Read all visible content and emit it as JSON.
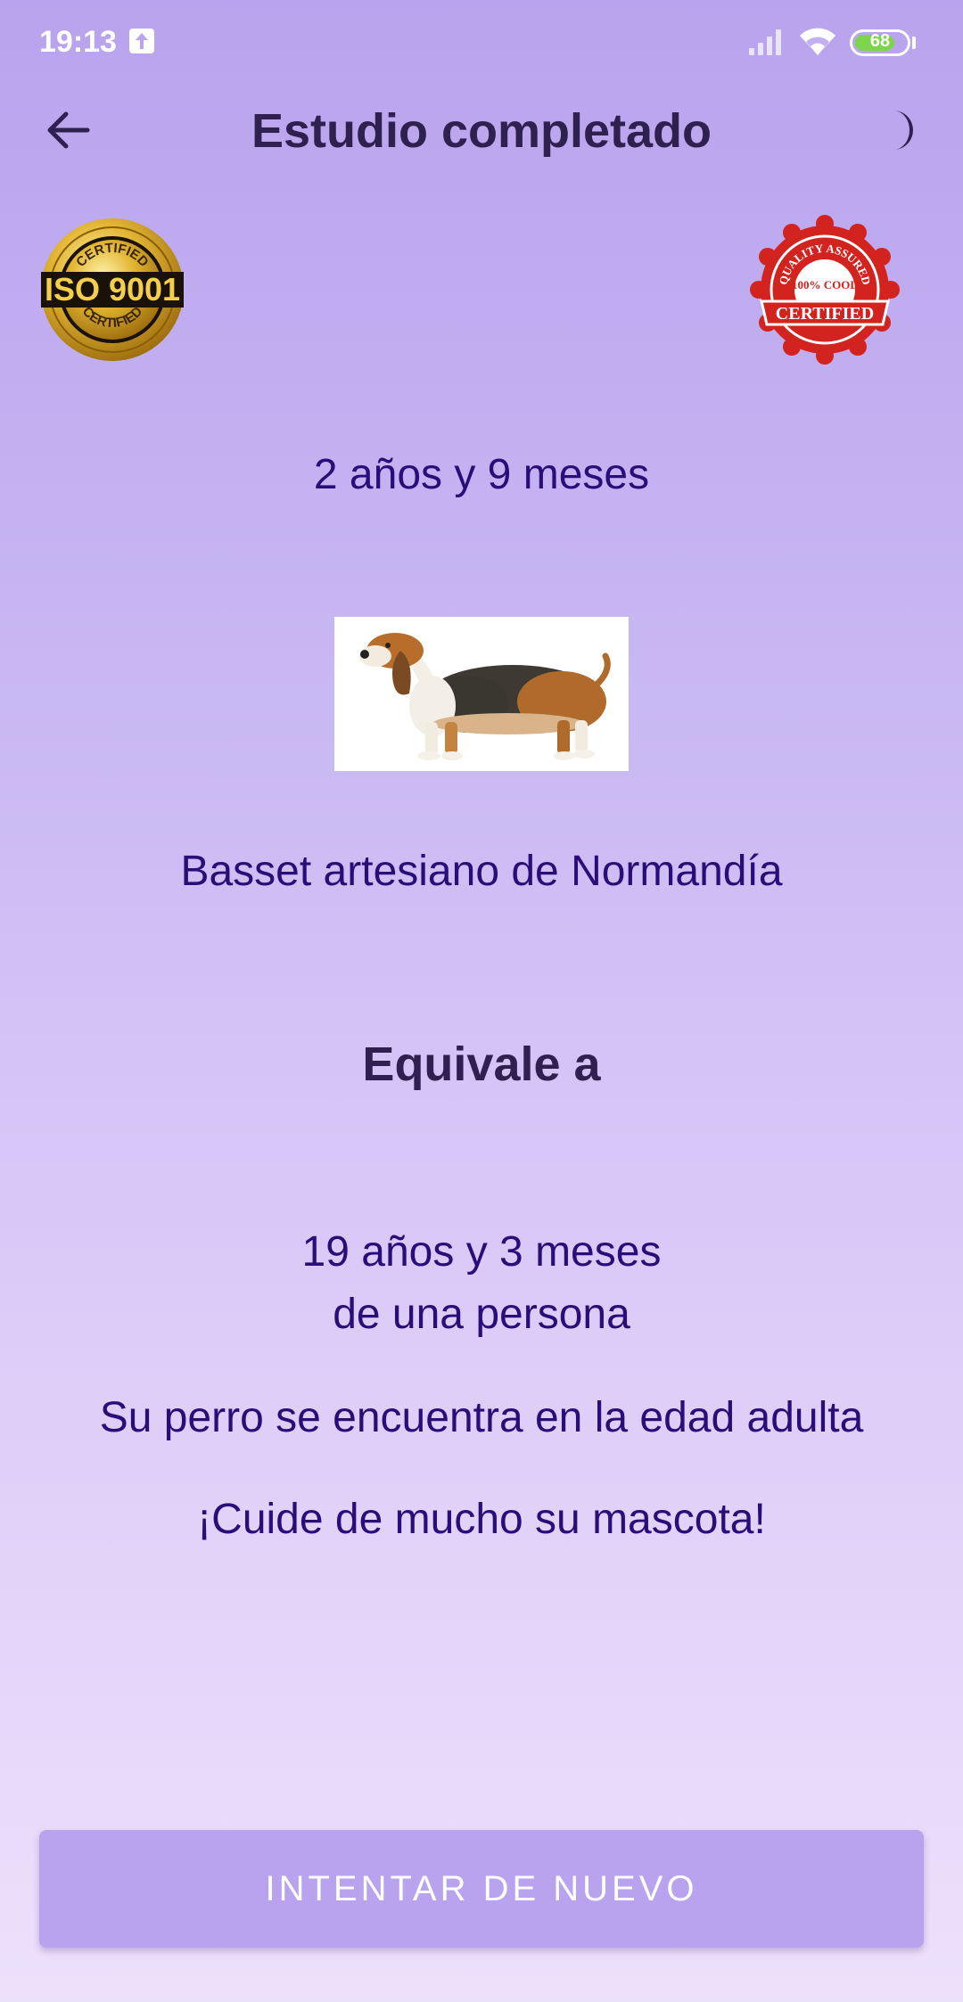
{
  "status_bar": {
    "time": "19:13",
    "battery_level": "68",
    "icons": [
      "upload-icon",
      "signal-icon",
      "wifi-icon",
      "battery-icon"
    ]
  },
  "app_bar": {
    "title": "Estudio completado",
    "back_icon": "arrow-left-icon",
    "theme_icon": "moon-icon"
  },
  "badges": {
    "left": {
      "icon": "iso-certified-badge",
      "text": "ISO 9001",
      "ring_text": "CERTIFIED"
    },
    "right": {
      "icon": "quality-certified-seal",
      "arc_text": "QUALITY ASSURED",
      "center_text": "100% COOL",
      "ribbon_text": "CERTIFIED"
    }
  },
  "result": {
    "dog_age": "2 años y 9 meses",
    "breed": "Basset artesiano de Normandía",
    "equivalent_label": "Equivale a",
    "human_age": "19 años y 3 meses",
    "human_suffix": "de una persona",
    "life_stage": "Su perro se encuentra en la edad adulta",
    "advice": "¡Cuide de mucho su mascota!"
  },
  "actions": {
    "retry_label": "INTENTAR DE NUEVO"
  },
  "colors": {
    "background_top": "#b9a3ee",
    "background_bottom": "#ece1fb",
    "text_primary": "#2a0d78",
    "title": "#2e2150",
    "button": "#b9a3ee"
  }
}
